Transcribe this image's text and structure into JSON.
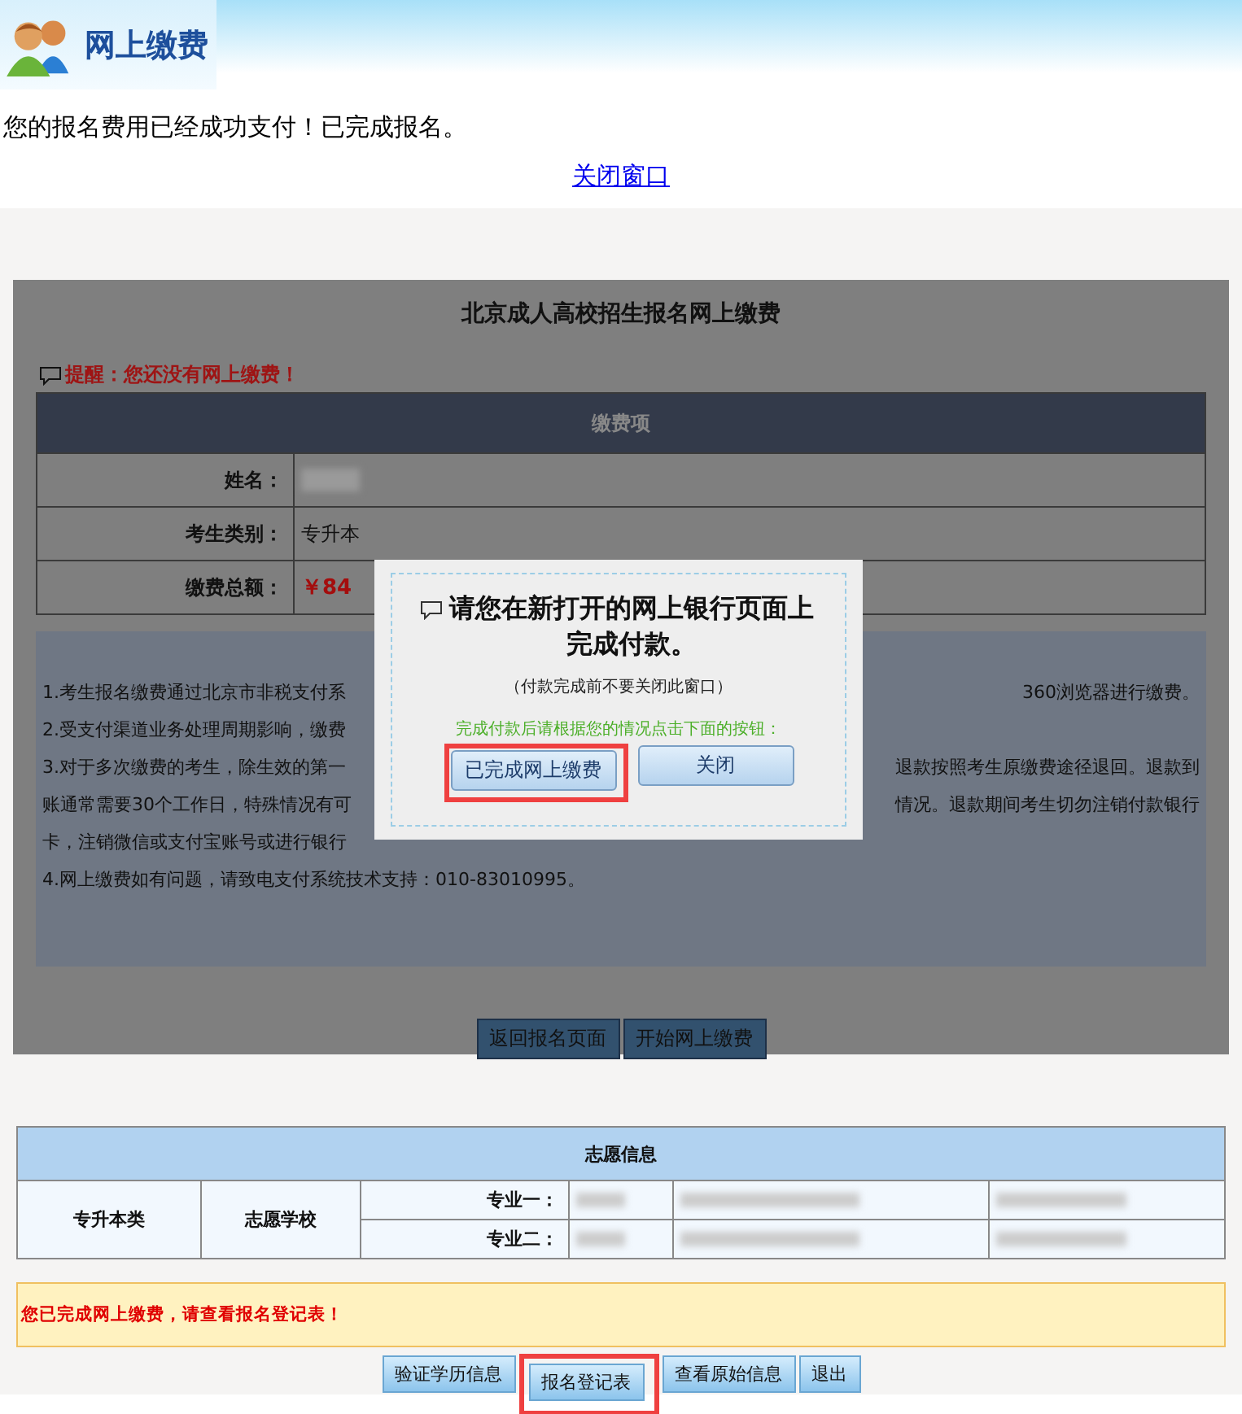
{
  "header": {
    "title": "网上缴费"
  },
  "message": "您的报名费用已经成功支付！已完成报名。",
  "close_link": "关闭窗口",
  "payment_page": {
    "title": "北京成人高校招生报名网上缴费",
    "reminder": "提醒：您还没有网上缴费！",
    "table_heading": "缴费项",
    "rows": [
      {
        "label": "姓名：",
        "kind": "blurred"
      },
      {
        "label": "考生类别：",
        "kind": "text",
        "value": "专升本"
      },
      {
        "label": "缴费总额：",
        "kind": "amount",
        "value": "￥84"
      }
    ],
    "notes": [
      {
        "left": "1.考生报名缴费通过北京市非税支付系",
        "right": "360浏览器进行缴费。"
      },
      {
        "left": "2.受支付渠道业务处理周期影响，缴费"
      },
      {
        "left": "3.对于多次缴费的考生，除生效的第一",
        "right": "退款按照考生原缴费途径退回。退款到"
      },
      {
        "left": "账通常需要30个工作日，特殊情况有可",
        "right": "情况。退款期间考生切勿注销付款银行"
      },
      {
        "left": "卡，注销微信或支付宝账号或进行银行"
      },
      {
        "left": "4.网上缴费如有问题，请致电支付系统技术支持：010-83010995。"
      }
    ],
    "buttons": [
      "返回报名页面",
      "开始网上缴费"
    ]
  },
  "dialog": {
    "title": "请您在新打开的网上银行页面上完成付款。",
    "hint": "（付款完成前不要关闭此窗口）",
    "instruction": "完成付款后请根据您的情况点击下面的按钮：",
    "buttons": [
      {
        "label": "已完成网上缴费",
        "highlighted": true
      },
      {
        "label": "关闭",
        "highlighted": false
      }
    ]
  },
  "wishes": {
    "heading": "志愿信息",
    "category": "专升本类",
    "school_label": "志愿学校",
    "majors": [
      {
        "label": "专业一："
      },
      {
        "label": "专业二："
      }
    ]
  },
  "notice": "您已完成网上缴费，请查看报名登记表！",
  "actions": [
    {
      "label": "验证学历信息",
      "highlighted": false
    },
    {
      "label": "报名登记表",
      "highlighted": true
    },
    {
      "label": "查看原始信息",
      "highlighted": false
    },
    {
      "label": "退出",
      "highlighted": false
    }
  ]
}
